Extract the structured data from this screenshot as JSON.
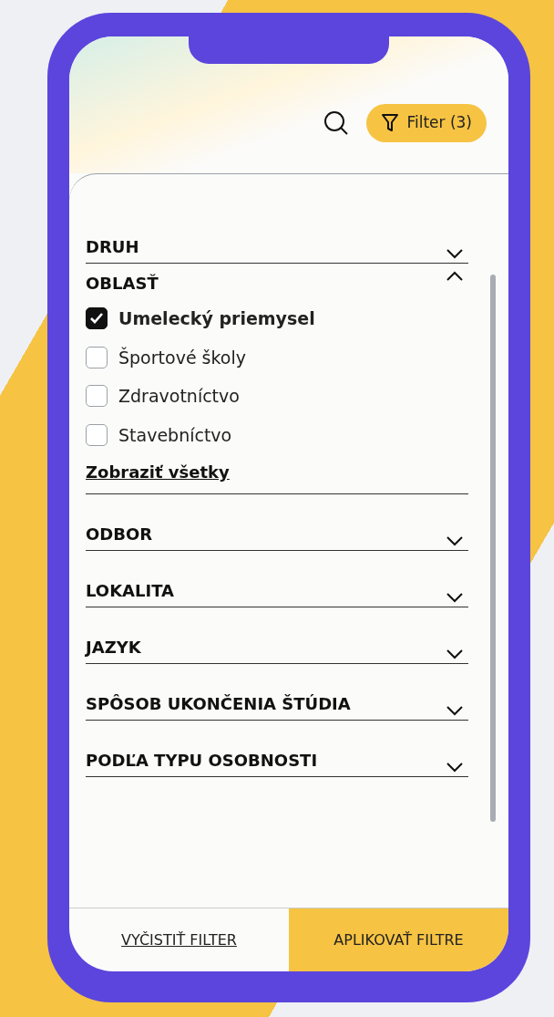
{
  "header": {
    "filter_button": "Filter (3)"
  },
  "sections": [
    {
      "title": "DRUH",
      "expanded": false
    },
    {
      "title": "OBLASŤ",
      "expanded": true,
      "options": [
        {
          "label": "Umelecký priemysel",
          "checked": true
        },
        {
          "label": "Športové školy",
          "checked": false
        },
        {
          "label": "Zdravotníctvo",
          "checked": false
        },
        {
          "label": "Stavebníctvo",
          "checked": false
        }
      ],
      "show_all": "Zobraziť všetky"
    },
    {
      "title": "ODBOR",
      "expanded": false
    },
    {
      "title": "LOKALITA",
      "expanded": false
    },
    {
      "title": "JAZYK",
      "expanded": false
    },
    {
      "title": "SPÔSOB UKONČENIA ŠTÚDIA",
      "expanded": false
    },
    {
      "title": "PODĽA TYPU OSOBNOSTI",
      "expanded": false
    }
  ],
  "footer": {
    "clear": "VYČISTIŤ FILTER",
    "apply": "APLIKOVAŤ FILTRE"
  }
}
